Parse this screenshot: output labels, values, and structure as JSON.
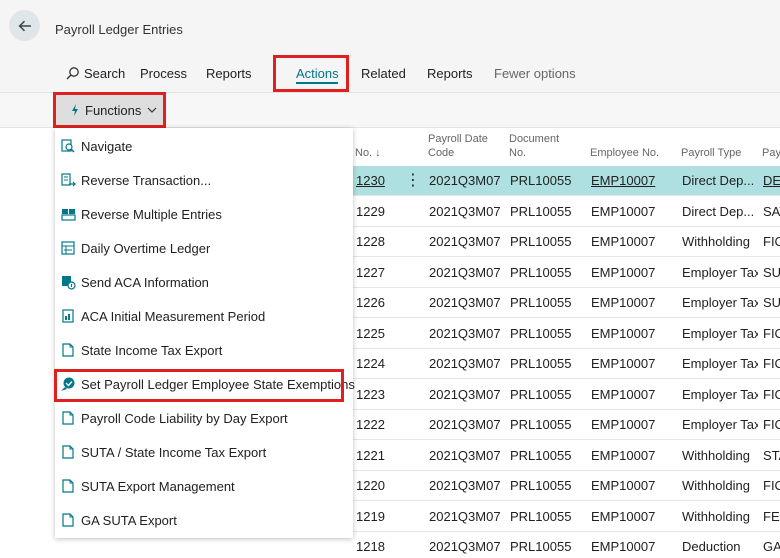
{
  "header": {
    "title": "Payroll Ledger Entries"
  },
  "actionbar": {
    "search": "Search",
    "process": "Process",
    "reports1": "Reports",
    "actions": "Actions",
    "related": "Related",
    "reports2": "Reports",
    "fewer": "Fewer options"
  },
  "functions": {
    "label": "Functions"
  },
  "menu": {
    "items": [
      {
        "label": "Navigate",
        "icon": "navigate-icon"
      },
      {
        "label": "Reverse Transaction...",
        "icon": "reverse-transaction-icon"
      },
      {
        "label": "Reverse Multiple Entries",
        "icon": "reverse-multiple-icon"
      },
      {
        "label": "Daily Overtime Ledger",
        "icon": "ledger-icon"
      },
      {
        "label": "Send ACA Information",
        "icon": "send-info-icon"
      },
      {
        "label": "ACA Initial Measurement Period",
        "icon": "report-icon"
      },
      {
        "label": "State Income Tax Export",
        "icon": "document-icon"
      },
      {
        "label": "Set Payroll Ledger Employee State Exemptions",
        "icon": "exemption-icon"
      },
      {
        "label": "Payroll Code Liability by Day Export",
        "icon": "document-icon"
      },
      {
        "label": "SUTA / State Income Tax Export",
        "icon": "document-icon"
      },
      {
        "label": "SUTA Export Management",
        "icon": "document-icon"
      },
      {
        "label": "GA SUTA Export",
        "icon": "document-icon"
      }
    ]
  },
  "table": {
    "headers": {
      "no": "No. ↓",
      "pdc1": "Payroll Date",
      "pdc2": "Code",
      "doc1": "Document",
      "doc2": "No.",
      "emp": "Employee No.",
      "ptype": "Payroll Type",
      "pay": "Pay"
    },
    "rows": [
      {
        "no": "1230",
        "pdc": "2021Q3M07",
        "doc": "PRL10055",
        "emp": "EMP10007",
        "ptype": "Direct Dep...",
        "code": "DEF"
      },
      {
        "no": "1229",
        "pdc": "2021Q3M07",
        "doc": "PRL10055",
        "emp": "EMP10007",
        "ptype": "Direct Dep...",
        "code": "SAV"
      },
      {
        "no": "1228",
        "pdc": "2021Q3M07",
        "doc": "PRL10055",
        "emp": "EMP10007",
        "ptype": "Withholding",
        "code": "FIC"
      },
      {
        "no": "1227",
        "pdc": "2021Q3M07",
        "doc": "PRL10055",
        "emp": "EMP10007",
        "ptype": "Employer Tax",
        "code": "SUT"
      },
      {
        "no": "1226",
        "pdc": "2021Q3M07",
        "doc": "PRL10055",
        "emp": "EMP10007",
        "ptype": "Employer Tax",
        "code": "SUT"
      },
      {
        "no": "1225",
        "pdc": "2021Q3M07",
        "doc": "PRL10055",
        "emp": "EMP10007",
        "ptype": "Employer Tax",
        "code": "FIC"
      },
      {
        "no": "1224",
        "pdc": "2021Q3M07",
        "doc": "PRL10055",
        "emp": "EMP10007",
        "ptype": "Employer Tax",
        "code": "FIC"
      },
      {
        "no": "1223",
        "pdc": "2021Q3M07",
        "doc": "PRL10055",
        "emp": "EMP10007",
        "ptype": "Employer Tax",
        "code": "FIC"
      },
      {
        "no": "1222",
        "pdc": "2021Q3M07",
        "doc": "PRL10055",
        "emp": "EMP10007",
        "ptype": "Employer Tax",
        "code": "FIC"
      },
      {
        "no": "1221",
        "pdc": "2021Q3M07",
        "doc": "PRL10055",
        "emp": "EMP10007",
        "ptype": "Withholding",
        "code": "STA"
      },
      {
        "no": "1220",
        "pdc": "2021Q3M07",
        "doc": "PRL10055",
        "emp": "EMP10007",
        "ptype": "Withholding",
        "code": "FIC"
      },
      {
        "no": "1219",
        "pdc": "2021Q3M07",
        "doc": "PRL10055",
        "emp": "EMP10007",
        "ptype": "Withholding",
        "code": "FED"
      },
      {
        "no": "1218",
        "pdc": "2021Q3M07",
        "doc": "PRL10055",
        "emp": "EMP10007",
        "ptype": "Deduction",
        "code": "GA"
      }
    ]
  },
  "colors": {
    "accent": "#00788a",
    "highlight": "#e0201e",
    "selected_row": "#aee0e1"
  }
}
